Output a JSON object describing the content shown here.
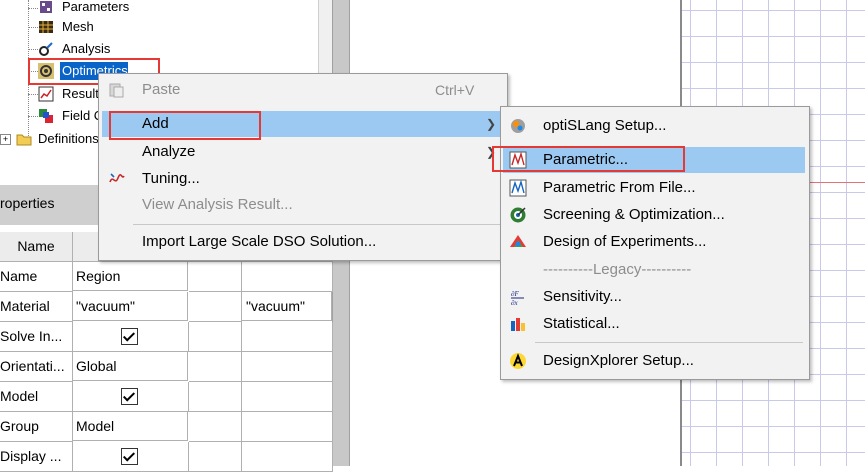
{
  "tree": {
    "items": [
      {
        "label": "Parameters",
        "icon": "parameters-icon"
      },
      {
        "label": "Mesh",
        "icon": "mesh-icon"
      },
      {
        "label": "Analysis",
        "icon": "analysis-icon"
      },
      {
        "label": "Optimetrics",
        "icon": "optimetrics-icon"
      },
      {
        "label": "Result",
        "icon": "results-icon"
      },
      {
        "label": "Field C",
        "icon": "field-overlays-icon"
      },
      {
        "label": "Definitions",
        "icon": "folder-icon"
      }
    ]
  },
  "properties": {
    "title": "roperties",
    "header": {
      "name": "Name"
    },
    "rows": [
      {
        "name": "Name",
        "value": "Region",
        "extra": "",
        "checked": false
      },
      {
        "name": "Material",
        "value": "\"vacuum\"",
        "extra": "\"vacuum\"",
        "checked": false
      },
      {
        "name": "Solve In...",
        "value": "",
        "extra": "",
        "checked": true
      },
      {
        "name": "Orientati...",
        "value": "Global",
        "extra": "",
        "checked": false
      },
      {
        "name": "Model",
        "value": "",
        "extra": "",
        "checked": true
      },
      {
        "name": "Group",
        "value": "Model",
        "extra": "",
        "checked": false
      },
      {
        "name": "Display ...",
        "value": "",
        "extra": "",
        "checked": true
      }
    ]
  },
  "context_menu": {
    "items": [
      {
        "label": "Paste",
        "shortcut": "Ctrl+V",
        "disabled": true
      },
      {
        "label": "Add",
        "highlighted": true,
        "submenu": true
      },
      {
        "label": "Analyze",
        "submenu": true
      },
      {
        "label": "Tuning...",
        "icon": "tuning-icon"
      },
      {
        "label": "View Analysis Result...",
        "disabled": true
      },
      {
        "label": "Import Large Scale DSO Solution..."
      }
    ]
  },
  "submenu": {
    "items": [
      {
        "label": "optiSLang Setup..."
      },
      {
        "label": "Parametric...",
        "highlighted": true
      },
      {
        "label": "Parametric From File..."
      },
      {
        "label": "Screening & Optimization..."
      },
      {
        "label": "Design of Experiments..."
      },
      {
        "label": "----------Legacy----------",
        "disabled": true
      },
      {
        "label": "Sensitivity..."
      },
      {
        "label": "Statistical..."
      },
      {
        "label": "DesignXplorer Setup..."
      }
    ]
  },
  "colors": {
    "highlight": "#9cc9f2",
    "annotation_red": "#e53935",
    "canvas_grid": "#c9c9ea"
  }
}
